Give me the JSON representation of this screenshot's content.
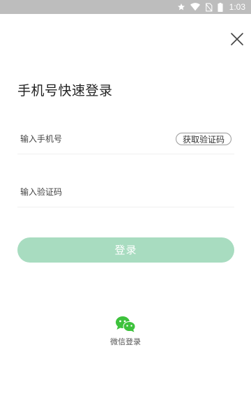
{
  "status_bar": {
    "time": "1:03",
    "icons": [
      "star-icon",
      "wifi-icon",
      "no-sim-icon",
      "battery-icon"
    ]
  },
  "header": {
    "close_icon": "close-icon",
    "title": "手机号快速登录"
  },
  "form": {
    "phone_placeholder": "输入手机号",
    "phone_value": "",
    "get_code_label": "获取验证码",
    "code_placeholder": "输入验证码",
    "code_value": "",
    "login_label": "登录"
  },
  "third_party": {
    "wechat_label": "微信登录",
    "wechat_icon": "wechat-icon"
  },
  "colors": {
    "status_bar": "#bdbdbd",
    "login_button_disabled": "#a8dcc0",
    "wechat_green": "#3dc23c"
  }
}
